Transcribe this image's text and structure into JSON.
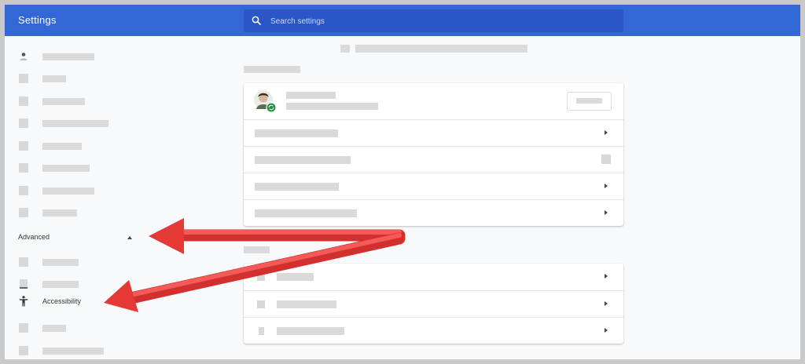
{
  "app": {
    "title": "Settings"
  },
  "search": {
    "placeholder": "Search settings"
  },
  "sidebar": {
    "items": [
      {
        "icon": "person-icon"
      },
      {
        "icon": "autofill-icon"
      },
      {
        "icon": "appearance-icon"
      },
      {
        "icon": "search-engine-icon"
      },
      {
        "icon": "default-browser-icon"
      },
      {
        "icon": "on-startup-icon"
      },
      {
        "icon": "extensions-icon"
      },
      {
        "icon": "about-icon"
      }
    ],
    "advanced": {
      "label": "Advanced",
      "expanded": true,
      "caret_icon": "chevron-up-icon"
    },
    "advanced_items": [
      {
        "icon": "privacy-icon"
      },
      {
        "icon": "downloads-icon"
      },
      {
        "label": "Accessibility",
        "icon": "accessibility-icon"
      },
      {
        "icon": "system-icon"
      },
      {
        "icon": "reset-icon"
      }
    ]
  },
  "annotation": {
    "arrow_color": "#e53935",
    "arrows": 2
  },
  "colors": {
    "header": "#3367d6",
    "search_bg": "#2a56c6",
    "page_bg": "#f8f9fa",
    "frame": "#c9c9c9"
  }
}
